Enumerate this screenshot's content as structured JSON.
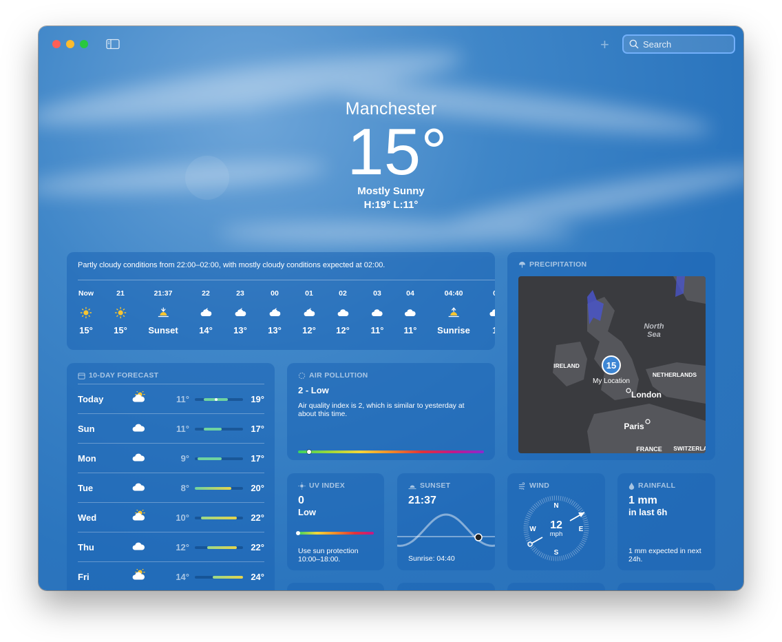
{
  "toolbar": {
    "add_label": "+",
    "search_placeholder": "Search"
  },
  "hero": {
    "city": "Manchester",
    "temperature": "15°",
    "condition": "Mostly Sunny",
    "high_low": "H:19°  L:11°"
  },
  "hourly": {
    "summary": "Partly cloudy conditions from 22:00–02:00, with mostly cloudy conditions expected at 02:00.",
    "items": [
      {
        "time": "Now",
        "icon": "sun-icon",
        "value": "15°"
      },
      {
        "time": "21",
        "icon": "sun-icon",
        "value": "15°"
      },
      {
        "time": "21:37",
        "icon": "sunset-icon",
        "value": "Sunset"
      },
      {
        "time": "22",
        "icon": "moon-cloud-icon",
        "value": "14°"
      },
      {
        "time": "23",
        "icon": "moon-cloud-icon",
        "value": "13°"
      },
      {
        "time": "00",
        "icon": "moon-cloud-icon",
        "value": "13°"
      },
      {
        "time": "01",
        "icon": "moon-cloud-icon",
        "value": "12°"
      },
      {
        "time": "02",
        "icon": "cloud-icon",
        "value": "12°"
      },
      {
        "time": "03",
        "icon": "cloud-icon",
        "value": "11°"
      },
      {
        "time": "04",
        "icon": "cloud-icon",
        "value": "11°"
      },
      {
        "time": "04:40",
        "icon": "sunrise-icon",
        "value": "Sunrise"
      },
      {
        "time": "0",
        "icon": "cloud-icon",
        "value": "1"
      }
    ]
  },
  "forecast": {
    "title": "10-DAY FORECAST",
    "range_min": 8,
    "range_max": 24,
    "days": [
      {
        "day": "Today",
        "icon": "sun-cloud-icon",
        "low": "11°",
        "high": "19°",
        "low_val": 11,
        "high_val": 19,
        "current": 15
      },
      {
        "day": "Sun",
        "icon": "cloud-icon",
        "low": "11°",
        "high": "17°",
        "low_val": 11,
        "high_val": 17
      },
      {
        "day": "Mon",
        "icon": "cloud-icon",
        "low": "9°",
        "high": "17°",
        "low_val": 9,
        "high_val": 17
      },
      {
        "day": "Tue",
        "icon": "cloud-icon",
        "low": "8°",
        "high": "20°",
        "low_val": 8,
        "high_val": 20
      },
      {
        "day": "Wed",
        "icon": "sun-cloud-icon",
        "low": "10°",
        "high": "22°",
        "low_val": 10,
        "high_val": 22
      },
      {
        "day": "Thu",
        "icon": "cloud-icon",
        "low": "12°",
        "high": "22°",
        "low_val": 12,
        "high_val": 22
      },
      {
        "day": "Fri",
        "icon": "sun-cloud-icon",
        "low": "14°",
        "high": "24°",
        "low_val": 14,
        "high_val": 24
      }
    ]
  },
  "air": {
    "title": "AIR POLLUTION",
    "value": "2 - Low",
    "description": "Air quality index is 2, which is similar to yesterday at about this time.",
    "level": 0.06
  },
  "precip": {
    "title": "PRECIPITATION",
    "badge": "15",
    "my_location": "My Location",
    "labels": {
      "north_sea": "North\nSea",
      "ireland": "IRELAND",
      "netherlands": "NETHERLANDS",
      "london": "London",
      "paris": "Paris",
      "france": "FRANCE",
      "switzerland": "SWITZERLA"
    }
  },
  "uv": {
    "title": "UV INDEX",
    "value": "0",
    "level_label": "Low",
    "note": "Use sun protection 10:00–18:00.",
    "level": 0.0
  },
  "sunset": {
    "title": "SUNSET",
    "time": "21:37",
    "sunrise": "Sunrise: 04:40"
  },
  "wind": {
    "title": "WIND",
    "speed": "12",
    "unit": "mph",
    "n": "N",
    "e": "E",
    "s": "S",
    "w": "W"
  },
  "rainfall": {
    "title": "RAINFALL",
    "amount": "1 mm",
    "period": "in last 6h",
    "note": "1 mm expected in next 24h."
  },
  "colors": {
    "accent": "#2b75be",
    "forecast_green": "#6fd3a0",
    "forecast_yellow": "#e6d44a"
  }
}
